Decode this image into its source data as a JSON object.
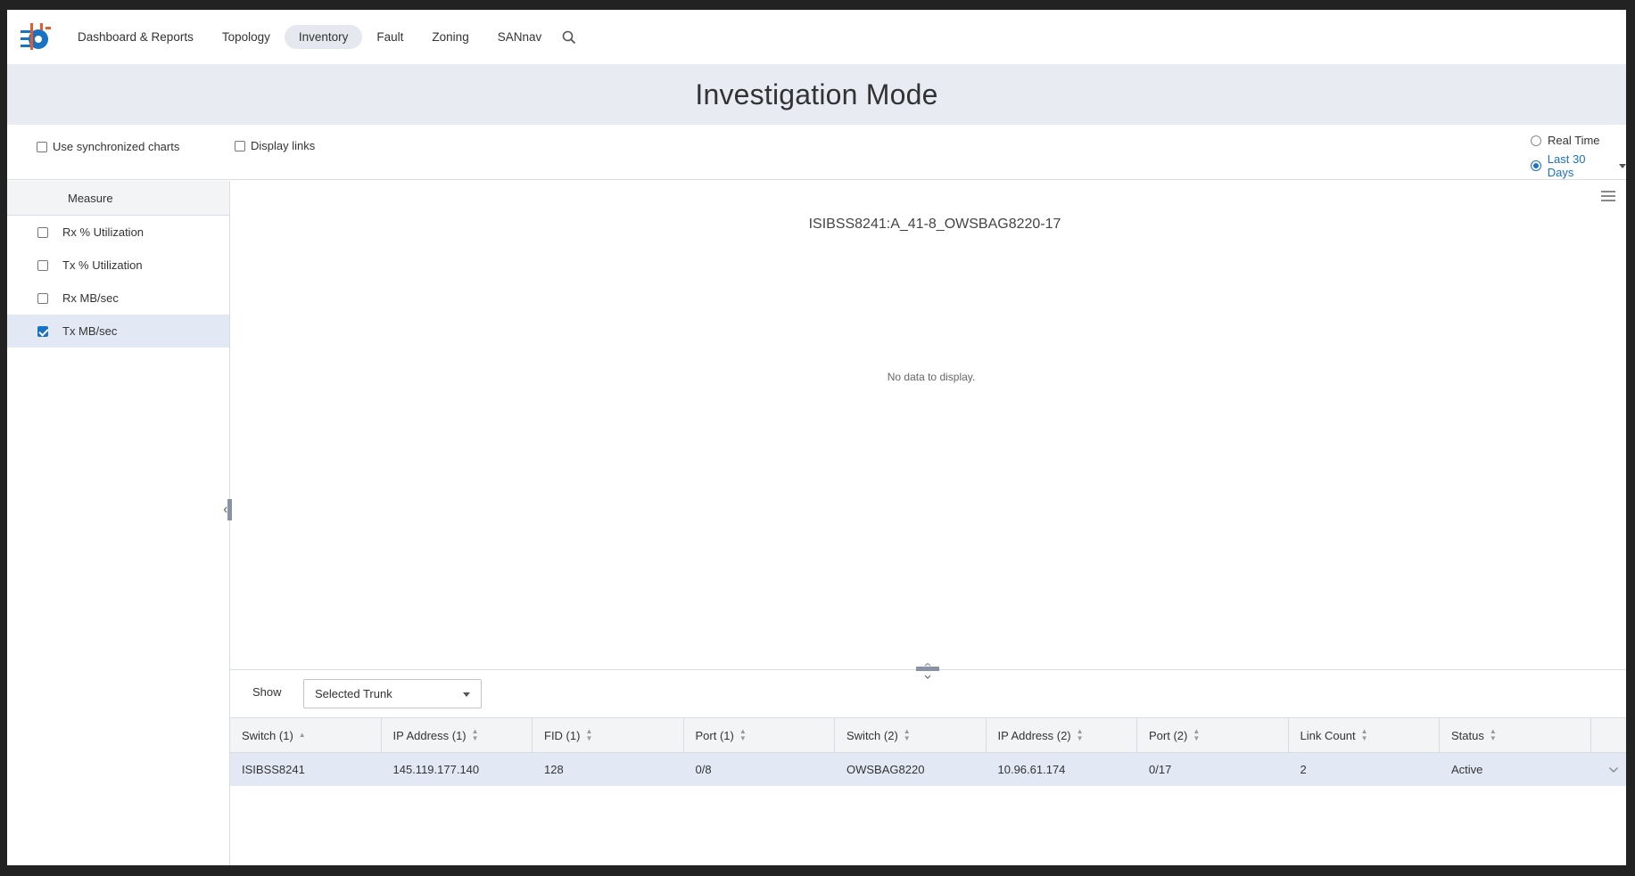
{
  "nav": {
    "items": [
      {
        "label": "Dashboard & Reports",
        "active": false
      },
      {
        "label": "Topology",
        "active": false
      },
      {
        "label": "Inventory",
        "active": true
      },
      {
        "label": "Fault",
        "active": false
      },
      {
        "label": "Zoning",
        "active": false
      },
      {
        "label": "SANnav",
        "active": false
      }
    ]
  },
  "page": {
    "title": "Investigation Mode"
  },
  "options": {
    "sync_charts_label": "Use synchronized charts",
    "display_links_label": "Display links",
    "real_time_label": "Real Time",
    "last_30_label": "Last 30 Days",
    "selected_range": "Last 30 Days"
  },
  "measure": {
    "header": "Measure",
    "items": [
      {
        "label": "Rx % Utilization",
        "checked": false
      },
      {
        "label": "Tx % Utilization",
        "checked": false
      },
      {
        "label": "Rx MB/sec",
        "checked": false
      },
      {
        "label": "Tx MB/sec",
        "checked": true
      }
    ]
  },
  "chart": {
    "title": "ISIBSS8241:A_41-8_OWSBAG8220-17",
    "empty_message": "No data to display."
  },
  "show": {
    "label": "Show",
    "selected": "Selected Trunk"
  },
  "table": {
    "columns": [
      "Switch (1)",
      "IP Address (1)",
      "FID (1)",
      "Port (1)",
      "Switch (2)",
      "IP Address (2)",
      "Port (2)",
      "Link Count",
      "Status"
    ],
    "rows": [
      [
        "ISIBSS8241",
        "145.119.177.140",
        "128",
        "0/8",
        "OWSBAG8220",
        "10.96.61.174",
        "0/17",
        "2",
        "Active"
      ]
    ]
  },
  "colors": {
    "accent": "#1a72c4",
    "band": "#e8ebf2",
    "selected_row": "#e3e9f4"
  }
}
